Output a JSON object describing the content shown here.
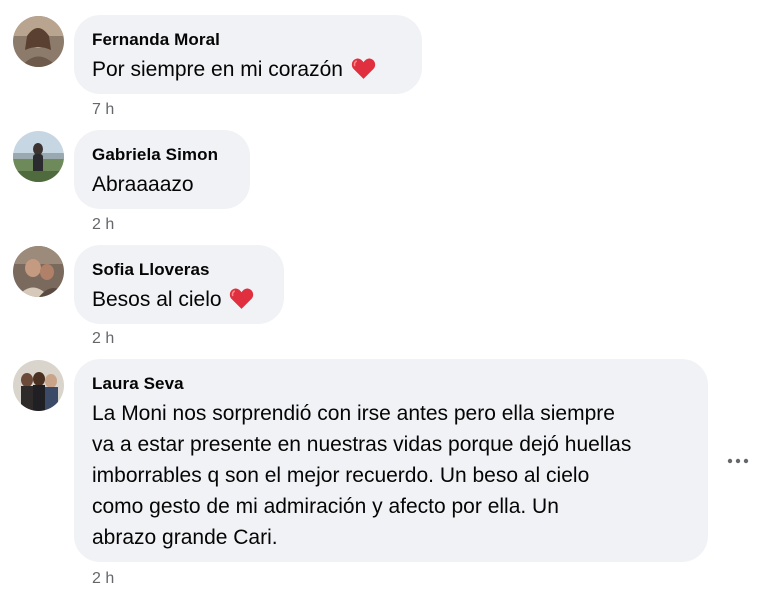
{
  "comments": [
    {
      "author": "Fernanda Moral",
      "text": "Por siempre en mi corazón",
      "emoji": "red-heart",
      "time": "7 h"
    },
    {
      "author": "Gabriela Simon",
      "text": "Abraaaazo",
      "time": "2 h"
    },
    {
      "author": "Sofia Lloveras",
      "text": "Besos al cielo",
      "emoji": "red-heart",
      "time": "2 h"
    },
    {
      "author": "Laura Seva",
      "text_lines": [
        "La Moni nos sorprendió con irse antes pero ella siempre",
        "va a estar presente en nuestras vidas porque dejó huellas",
        "imborrables q son el mejor recuerdo. Un beso al cielo",
        "como gesto de mi admiración y afecto por ella. Un",
        "abrazo grande Cari."
      ],
      "time": "2 h"
    }
  ],
  "colors": {
    "bubble": "#f0f2f5",
    "meta_text": "#65676b",
    "heart": "#e0303f"
  },
  "icons": [
    "avatar-photo",
    "red-heart-emoji",
    "more-options-icon"
  ]
}
